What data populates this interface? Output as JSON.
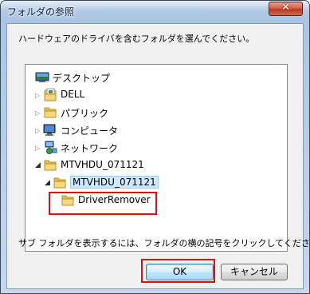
{
  "window": {
    "title": "フォルダの参照",
    "close_glyph": "✕"
  },
  "dialog": {
    "prompt": "ハードウェアのドライバを含むフォルダを選んでください。",
    "hint": "サブ フォルダを表示するには、フォルダの横の記号をクリックしてください。"
  },
  "tree": {
    "items": [
      {
        "label": "デスクトップ",
        "icon": "desktop-icon",
        "expander": "none"
      },
      {
        "label": "DELL",
        "icon": "user-folder-icon",
        "expander": "collapsed"
      },
      {
        "label": "パブリック",
        "icon": "folder-icon",
        "expander": "collapsed"
      },
      {
        "label": "コンピュータ",
        "icon": "computer-icon",
        "expander": "collapsed"
      },
      {
        "label": "ネットワーク",
        "icon": "network-icon",
        "expander": "collapsed"
      },
      {
        "label": "MTVHDU_071121",
        "icon": "folder-icon",
        "expander": "expanded"
      },
      {
        "label": "MTVHDU_071121",
        "icon": "folder-icon",
        "expander": "expanded",
        "selected": true
      },
      {
        "label": "DriverRemover",
        "icon": "folder-icon",
        "expander": "none"
      }
    ],
    "expander_glyphs": {
      "collapsed": "▷",
      "expanded": "◢"
    }
  },
  "buttons": {
    "ok": "OK",
    "cancel": "キャンセル"
  },
  "colors": {
    "highlight": "#e01010",
    "folder": "#f0c95a",
    "selection": "#cde8ff"
  }
}
